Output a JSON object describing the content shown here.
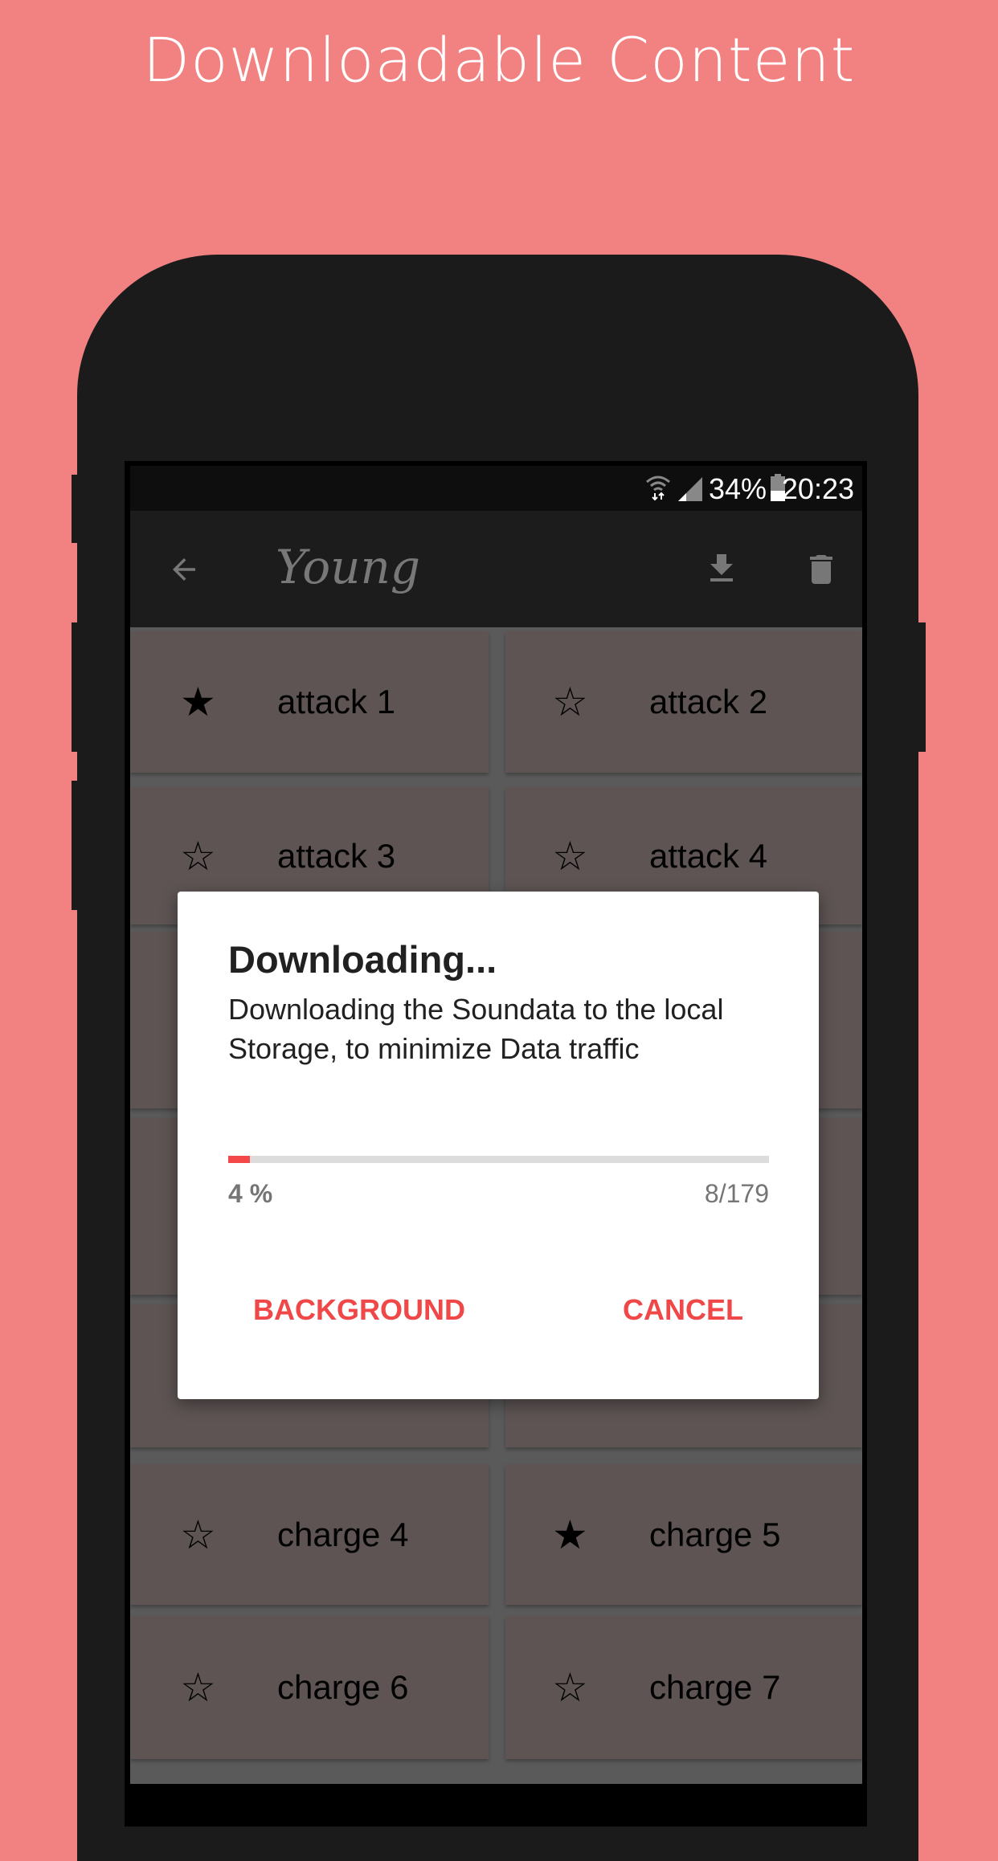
{
  "headline": "Downloadable Content",
  "status_bar": {
    "battery": "34%",
    "time": "20:23",
    "icons": [
      "wifi-icon",
      "signal-icon",
      "battery-icon"
    ]
  },
  "toolbar": {
    "title": "Young",
    "back_icon": "arrow-left-icon",
    "download_icon": "download-icon",
    "delete_icon": "trash-icon"
  },
  "grid": {
    "rows": [
      [
        {
          "label": "attack 1",
          "favorite": true
        },
        {
          "label": "attack 2",
          "favorite": false
        }
      ],
      [
        {
          "label": "attack 3",
          "favorite": false
        },
        {
          "label": "attack 4",
          "favorite": false
        }
      ],
      [
        {
          "label": "",
          "favorite": false
        },
        {
          "label": "",
          "favorite": false
        }
      ],
      [
        {
          "label": "",
          "favorite": false
        },
        {
          "label": "",
          "favorite": false
        }
      ],
      [
        {
          "label": "",
          "favorite": false
        },
        {
          "label": "",
          "favorite": false
        }
      ],
      [
        {
          "label": "charge 4",
          "favorite": false
        },
        {
          "label": "charge 5",
          "favorite": true
        }
      ],
      [
        {
          "label": "charge 6",
          "favorite": false
        },
        {
          "label": "charge 7",
          "favorite": false
        }
      ]
    ]
  },
  "dialog": {
    "title": "Downloading...",
    "message": "Downloading the Soundata to the local Storage, to minimize Data traffic",
    "progress_percent": 4,
    "percent_label": "4 %",
    "count_label": "8/179",
    "background_button": "BACKGROUND",
    "cancel_button": "CANCEL"
  },
  "colors": {
    "background": "#F28281",
    "accent": "#F04848",
    "cell": "#5D5453",
    "toolbar": "#1D1C1D"
  }
}
